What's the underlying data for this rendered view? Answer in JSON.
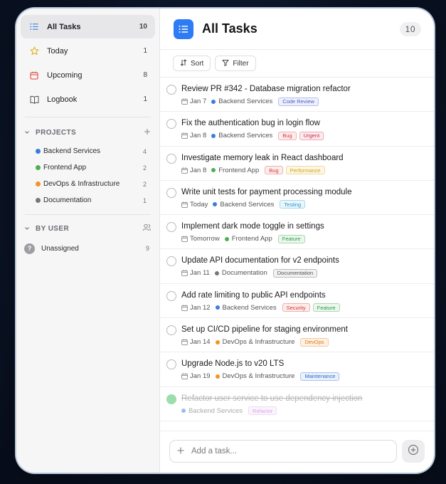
{
  "sidebar": {
    "nav": [
      {
        "label": "All Tasks",
        "count": "10",
        "icon": "list-icon"
      },
      {
        "label": "Today",
        "count": "1",
        "icon": "star-icon"
      },
      {
        "label": "Upcoming",
        "count": "8",
        "icon": "calendar-icon"
      },
      {
        "label": "Logbook",
        "count": "1",
        "icon": "book-icon"
      }
    ],
    "projects_heading": "PROJECTS",
    "projects": [
      {
        "label": "Backend Services",
        "count": "4",
        "color": "#3b7ddd"
      },
      {
        "label": "Frontend App",
        "count": "2",
        "color": "#4cb050"
      },
      {
        "label": "DevOps & Infrastructure",
        "count": "2",
        "color": "#f0942b"
      },
      {
        "label": "Documentation",
        "count": "1",
        "color": "#777777"
      }
    ],
    "users_heading": "BY USER",
    "users": [
      {
        "label": "Unassigned",
        "count": "9",
        "avatar": "?"
      }
    ]
  },
  "header": {
    "title": "All Tasks",
    "count": "10"
  },
  "toolbar": {
    "sort_label": "Sort",
    "filter_label": "Filter"
  },
  "tasks": [
    {
      "title": "Review PR #342 - Database migration refactor",
      "date": "Jan 7",
      "project": "Backend Services",
      "project_color": "#3b7ddd",
      "tags": [
        {
          "label": "Code Review",
          "color": "#4a5fc9",
          "bg": "#eef0fb"
        }
      ]
    },
    {
      "title": "Fix the authentication bug in login flow",
      "date": "Jan 8",
      "project": "Backend Services",
      "project_color": "#3b7ddd",
      "tags": [
        {
          "label": "Bug",
          "color": "#d9363e",
          "bg": "#fdeeee"
        },
        {
          "label": "Urgent",
          "color": "#c9284a",
          "bg": "#fdebee"
        }
      ]
    },
    {
      "title": "Investigate memory leak in React dashboard",
      "date": "Jan 8",
      "project": "Frontend App",
      "project_color": "#4cb050",
      "tags": [
        {
          "label": "Bug",
          "color": "#d9363e",
          "bg": "#fdeeee"
        },
        {
          "label": "Performance",
          "color": "#d1a21a",
          "bg": "#fdf7e3"
        }
      ]
    },
    {
      "title": "Write unit tests for payment processing module",
      "date": "Today",
      "project": "Backend Services",
      "project_color": "#3b7ddd",
      "tags": [
        {
          "label": "Testing",
          "color": "#2a9bc9",
          "bg": "#e9f6fc"
        }
      ]
    },
    {
      "title": "Implement dark mode toggle in settings",
      "date": "Tomorrow",
      "project": "Frontend App",
      "project_color": "#4cb050",
      "tags": [
        {
          "label": "Feature",
          "color": "#2f9a45",
          "bg": "#ebf7ed"
        }
      ]
    },
    {
      "title": "Update API documentation for v2 endpoints",
      "date": "Jan 11",
      "project": "Documentation",
      "project_color": "#777777",
      "tags": [
        {
          "label": "Documentation",
          "color": "#555555",
          "bg": "#f1f1f2"
        }
      ]
    },
    {
      "title": "Add rate limiting to public API endpoints",
      "date": "Jan 12",
      "project": "Backend Services",
      "project_color": "#3b7ddd",
      "tags": [
        {
          "label": "Security",
          "color": "#cc3a2e",
          "bg": "#fdeceb"
        },
        {
          "label": "Feature",
          "color": "#2f9a45",
          "bg": "#ebf7ed"
        }
      ]
    },
    {
      "title": "Set up CI/CD pipeline for staging environment",
      "date": "Jan 14",
      "project": "DevOps & Infrastructure",
      "project_color": "#f0942b",
      "tags": [
        {
          "label": "DevOps",
          "color": "#e07a14",
          "bg": "#fdf1e3"
        }
      ]
    },
    {
      "title": "Upgrade Node.js to v20 LTS",
      "date": "Jan 19",
      "project": "DevOps & Infrastructure",
      "project_color": "#f0942b",
      "tags": [
        {
          "label": "Maintenance",
          "color": "#2e6bc9",
          "bg": "#eaf1fc"
        }
      ]
    },
    {
      "title": "Refactor user service to use dependency injection",
      "date": "",
      "project": "Backend Services",
      "project_color": "#3b7ddd",
      "completed": true,
      "tags": [
        {
          "label": "Refactor",
          "color": "#b44ad1",
          "bg": "#f7ecfb"
        }
      ]
    }
  ],
  "composer": {
    "placeholder": "Add a task..."
  },
  "colors": {
    "accent": "#2f7bf5",
    "done": "#4cc36b"
  }
}
